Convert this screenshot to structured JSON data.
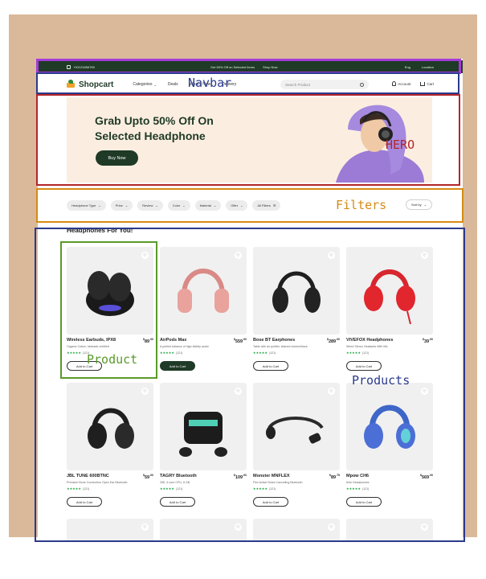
{
  "topbar": {
    "phone": "+00123456789",
    "promo": "Get 50% Off on Selected Items",
    "shop_now": "Shop Now",
    "language": "Eng",
    "location": "Location"
  },
  "navbar": {
    "logo": "Shopcart",
    "links": [
      "Categories",
      "Deals",
      "What's New",
      "Delivery"
    ],
    "search_placeholder": "Search Product",
    "account": "Account",
    "cart": "Cart"
  },
  "hero": {
    "title": "Grab Upto 50% Off On Selected Headphone",
    "button": "Buy Now"
  },
  "filters": {
    "chips": [
      "Headphone Type",
      "Price",
      "Review",
      "Color",
      "Material",
      "Offer",
      "All Filters"
    ],
    "sort": "Sort by"
  },
  "section": {
    "title": "Headphones For You!"
  },
  "products": [
    {
      "name": "Wireless Earbuds, IPX8",
      "price": "89",
      "cents": ".00",
      "desc": "Organic Cotton, fairtrade certified",
      "stars": "★★★★★",
      "count": "(121)",
      "button": "Add to Cart",
      "filled": false,
      "art": "earbuds-dark"
    },
    {
      "name": "AirPods Max",
      "price": "559",
      "cents": ".00",
      "desc": "A perfect balance of high-fidelity audio",
      "stars": "★★★★★",
      "count": "(121)",
      "button": "Add to Cart",
      "filled": true,
      "art": "max-pink"
    },
    {
      "name": "Bose BT Earphones",
      "price": "289",
      "cents": ".00",
      "desc": "Table with air purifier, stained veneer/black",
      "stars": "★★★★★",
      "count": "(121)",
      "button": "Add to Cart",
      "filled": false,
      "art": "bose-black"
    },
    {
      "name": "VIVEFOX Headphones",
      "price": "39",
      "cents": ".00",
      "desc": "Wired Stereo Headsets With Mic",
      "stars": "★★★★★",
      "count": "(121)",
      "button": "Add to Cart",
      "filled": false,
      "art": "red"
    },
    {
      "name": "JBL TUNE 600BTNC",
      "price": "59",
      "cents": ".00",
      "desc": "Premium Bone Conduction Open Ear Bluetooth",
      "stars": "★★★★★",
      "count": "(121)",
      "button": "Add to Cart",
      "filled": false,
      "art": "jbl-black"
    },
    {
      "name": "TAGRY Bluetooth",
      "price": "109",
      "cents": ".00",
      "desc": "25E, 6 core CPU, 8 GB",
      "stars": "★★★★★",
      "count": "(121)",
      "button": "Add to Cart",
      "filled": false,
      "art": "tagry"
    },
    {
      "name": "Monster MNFLEX",
      "price": "89",
      "cents": ".75",
      "desc": "Flex Active Noise Cancelling Bluetooth",
      "stars": "★★★★★",
      "count": "(121)",
      "button": "Add to Cart",
      "filled": false,
      "art": "bone"
    },
    {
      "name": "Mpow CH6",
      "price": "569",
      "cents": ".00",
      "desc": "Kids Headphones",
      "stars": "★★★★★",
      "count": "(121)",
      "button": "Add to Cart",
      "filled": false,
      "art": "kids-blue"
    },
    {
      "name": "",
      "price": "",
      "cents": "",
      "desc": "",
      "stars": "",
      "count": "",
      "button": "",
      "filled": false,
      "art": "partial"
    },
    {
      "name": "",
      "price": "",
      "cents": "",
      "desc": "",
      "stars": "",
      "count": "",
      "button": "",
      "filled": false,
      "art": "partial"
    },
    {
      "name": "",
      "price": "",
      "cents": "",
      "desc": "",
      "stars": "",
      "count": "",
      "button": "",
      "filled": false,
      "art": "partial"
    },
    {
      "name": "",
      "price": "",
      "cents": "",
      "desc": "",
      "stars": "",
      "count": "",
      "button": "",
      "filled": false,
      "art": "partial"
    }
  ],
  "annotations": {
    "navbar": "Navbar",
    "hero": "HERO",
    "filters": "Filters",
    "product": "Product",
    "products": "Products",
    "colors": {
      "purple": "#a43ad8",
      "navy": "#2b3a8c",
      "red": "#b3262a",
      "orange": "#d78a14",
      "green": "#5a9a2a",
      "blue": "#2b3a8c"
    }
  }
}
